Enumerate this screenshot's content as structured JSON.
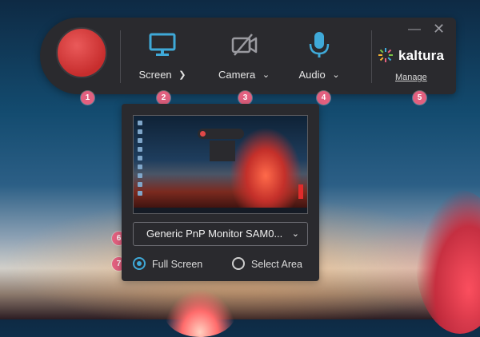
{
  "toolbar": {
    "sources": [
      {
        "label": "Screen",
        "chevron": "chevron-up-icon",
        "icon": "monitor-icon",
        "color": "#3fa9d8",
        "active": true
      },
      {
        "label": "Camera",
        "chevron": "chevron-down-icon",
        "icon": "camera-off-icon",
        "color": "#9a9aa0",
        "active": false
      },
      {
        "label": "Audio",
        "chevron": "chevron-down-icon",
        "icon": "microphone-icon",
        "color": "#3fa9d8",
        "active": true
      }
    ],
    "brand": "kaltura",
    "manage_label": "Manage",
    "minimize_icon": "minimize-icon",
    "close_icon": "close-icon"
  },
  "badges": [
    "1",
    "2",
    "3",
    "4",
    "5",
    "6",
    "7"
  ],
  "panel": {
    "monitor_select_value": "Generic PnP Monitor SAM0...",
    "options": [
      {
        "label": "Full Screen",
        "checked": true
      },
      {
        "label": "Select Area",
        "checked": false
      }
    ]
  },
  "colors": {
    "accent": "#3fa9d8",
    "record": "#d63c3c",
    "badge": "#e2607f",
    "panel_bg": "#2a2a2e"
  }
}
